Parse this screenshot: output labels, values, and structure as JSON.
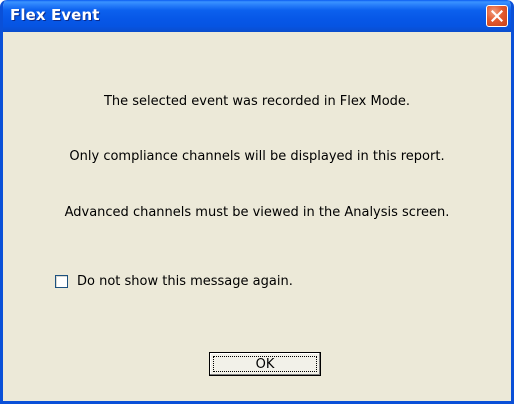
{
  "window": {
    "title": "Flex Event"
  },
  "messages": [
    "The selected event was recorded in Flex Mode.",
    "Only compliance channels will be displayed in this report.",
    "Advanced channels must be viewed in the Analysis screen."
  ],
  "checkbox": {
    "label": "Do not show this message again.",
    "checked": false
  },
  "buttons": {
    "ok_label": "OK"
  },
  "icons": {
    "close": "close-icon"
  },
  "colors": {
    "titlebar": "#0654e2",
    "dialog_background": "#ece9d8",
    "close_button": "#e35a2e"
  }
}
